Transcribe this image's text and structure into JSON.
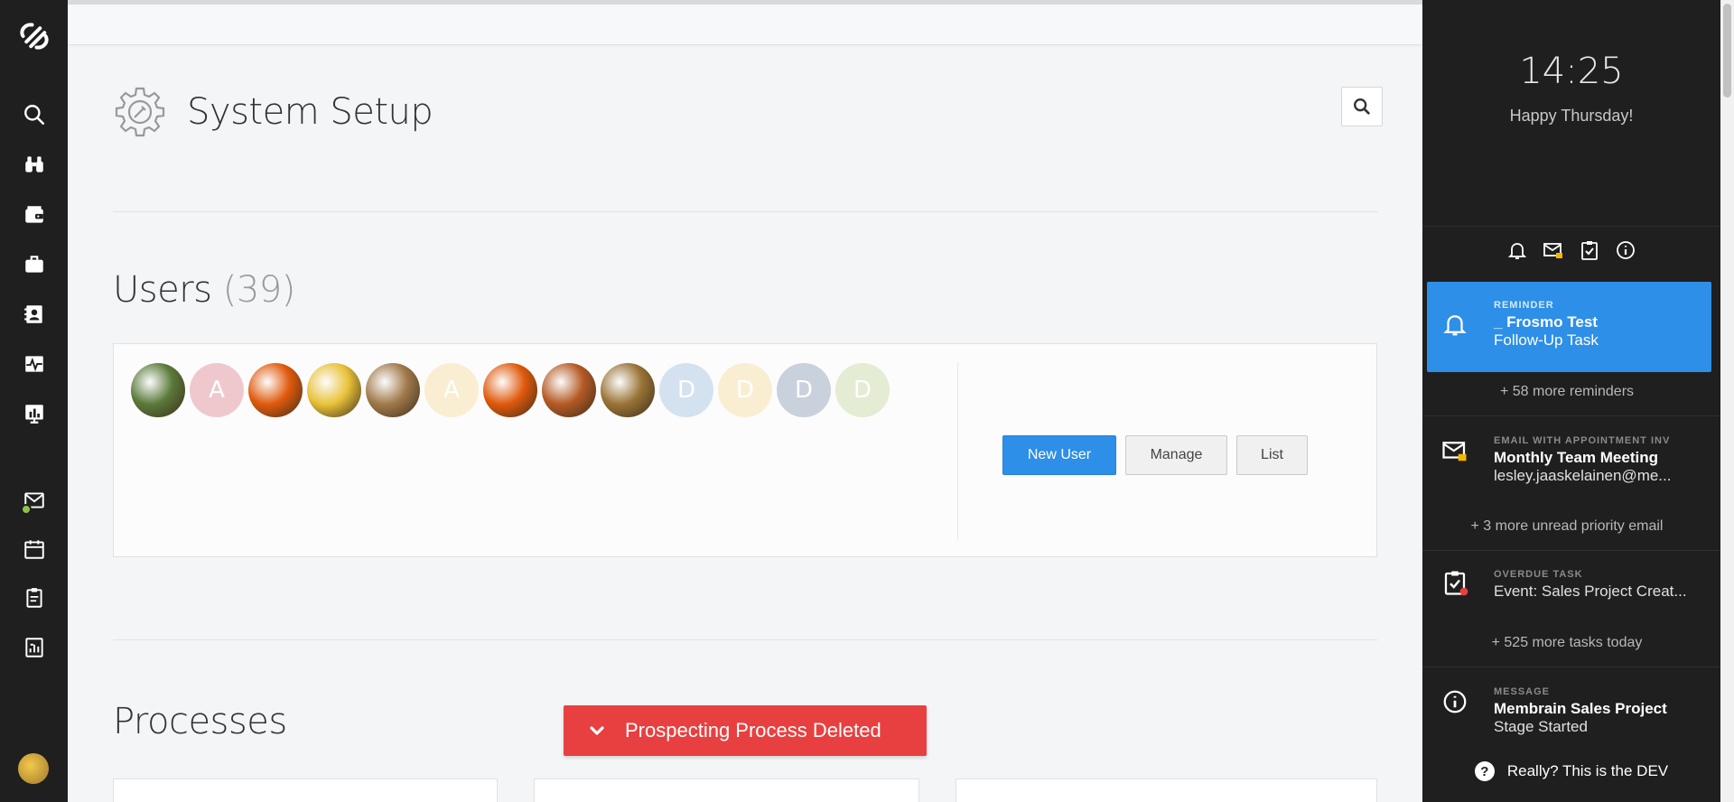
{
  "page": {
    "title": "System Setup"
  },
  "nav": {
    "items": [
      {
        "icon": "logo-icon"
      },
      {
        "icon": "search-icon"
      },
      {
        "icon": "binoculars-icon"
      },
      {
        "icon": "wallet-icon"
      },
      {
        "icon": "briefcase-icon"
      },
      {
        "icon": "contacts-icon"
      },
      {
        "icon": "activity-icon"
      },
      {
        "icon": "chart-board-icon"
      },
      {
        "icon": "mail-icon"
      },
      {
        "icon": "calendar-icon"
      },
      {
        "icon": "clipboard-icon"
      },
      {
        "icon": "report-icon"
      }
    ]
  },
  "users": {
    "title": "Users",
    "count": "(39)",
    "avatars": [
      {
        "type": "photo",
        "color": "#5b7a3a",
        "label": ""
      },
      {
        "type": "initial",
        "color": "#efc8cd",
        "label": "A"
      },
      {
        "type": "photo",
        "color": "#e05a0c",
        "label": ""
      },
      {
        "type": "photo",
        "color": "#e9c23a",
        "label": ""
      },
      {
        "type": "photo",
        "color": "#a17a4b",
        "label": ""
      },
      {
        "type": "initial",
        "color": "#faeed2",
        "label": "A"
      },
      {
        "type": "photo",
        "color": "#e05a0c",
        "label": ""
      },
      {
        "type": "photo",
        "color": "#b55a24",
        "label": ""
      },
      {
        "type": "photo",
        "color": "#9a7436",
        "label": ""
      },
      {
        "type": "initial",
        "color": "#d4e2f0",
        "label": "D"
      },
      {
        "type": "initial",
        "color": "#faeed2",
        "label": "D"
      },
      {
        "type": "initial",
        "color": "#c9d1dc",
        "label": "D"
      },
      {
        "type": "initial",
        "color": "#e4ecd3",
        "label": "D"
      }
    ],
    "buttons": {
      "new_user": "New User",
      "manage": "Manage",
      "list": "List"
    }
  },
  "processes": {
    "title": "Processes"
  },
  "toast": {
    "message": "Prospecting Process Deleted",
    "color": "#e84040"
  },
  "panel": {
    "clock": "14:25",
    "greeting": "Happy Thursday!",
    "notifications": [
      {
        "kind": "REMINDER",
        "line1": "_ Frosmo Test",
        "line2": "Follow-Up Task",
        "icon": "bell-icon"
      },
      {
        "kind": "EMAIL WITH APPOINTMENT INV",
        "line1": "Monthly Team Meeting",
        "line2": "lesley.jaaskelainen@me...",
        "icon": "mail-lock-icon"
      },
      {
        "kind": "OVERDUE TASK",
        "line1": "",
        "line2": "Event: Sales Project Creat...",
        "icon": "task-alert-icon"
      },
      {
        "kind": "MESSAGE",
        "line1": "Membrain Sales Project",
        "line2": "Stage Started",
        "icon": "info-icon"
      }
    ],
    "more": {
      "reminders": "+ 58 more reminders",
      "emails": "+ 3 more unread priority email",
      "tasks": "+ 525 more tasks today"
    },
    "footer": "Really? This is the DEV",
    "accent": "#2d8fe8"
  }
}
